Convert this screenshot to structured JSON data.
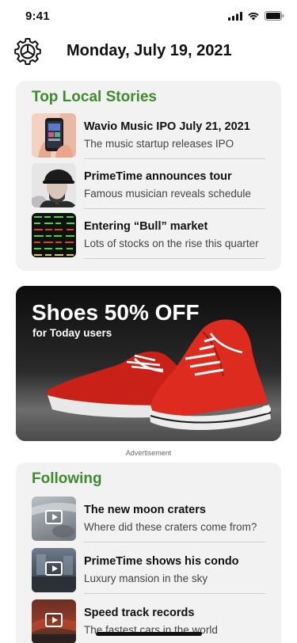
{
  "status_bar": {
    "time": "9:41",
    "icons": [
      "signal-icon",
      "wifi-icon",
      "battery-icon"
    ]
  },
  "header": {
    "date": "Monday, July 19, 2021",
    "settings_icon": "gear-icon"
  },
  "top_stories": {
    "title": "Top Local Stories",
    "items": [
      {
        "title": "Wavio Music IPO July 21, 2021",
        "subtitle": "The music startup releases IPO",
        "thumb": "phone-in-hand-image"
      },
      {
        "title": "PrimeTime announces tour",
        "subtitle": "Famous musician reveals schedule",
        "thumb": "musician-portrait-image"
      },
      {
        "title": "Entering “Bull” market",
        "subtitle": "Lots of stocks on the rise this quarter",
        "thumb": "stock-board-image"
      }
    ]
  },
  "ad": {
    "headline": "Shoes 50% OFF",
    "subline": "for Today users",
    "caption": "Advertisement",
    "image": "red-sneakers-image"
  },
  "following": {
    "title": "Following",
    "items": [
      {
        "title": "The new moon craters",
        "subtitle": "Where did these craters come from?",
        "thumb": "video-thumbnail",
        "icon": "play-icon"
      },
      {
        "title": "PrimeTime shows his condo",
        "subtitle": "Luxury mansion in the sky",
        "thumb": "video-thumbnail",
        "icon": "play-icon"
      },
      {
        "title": "Speed track records",
        "subtitle": "The fastest cars in the world",
        "thumb": "video-thumbnail",
        "icon": "play-icon"
      }
    ]
  },
  "colors": {
    "accent_green": "#3e8a2c",
    "card_bg": "#f2f2f2",
    "ad_red": "#d8261d"
  }
}
